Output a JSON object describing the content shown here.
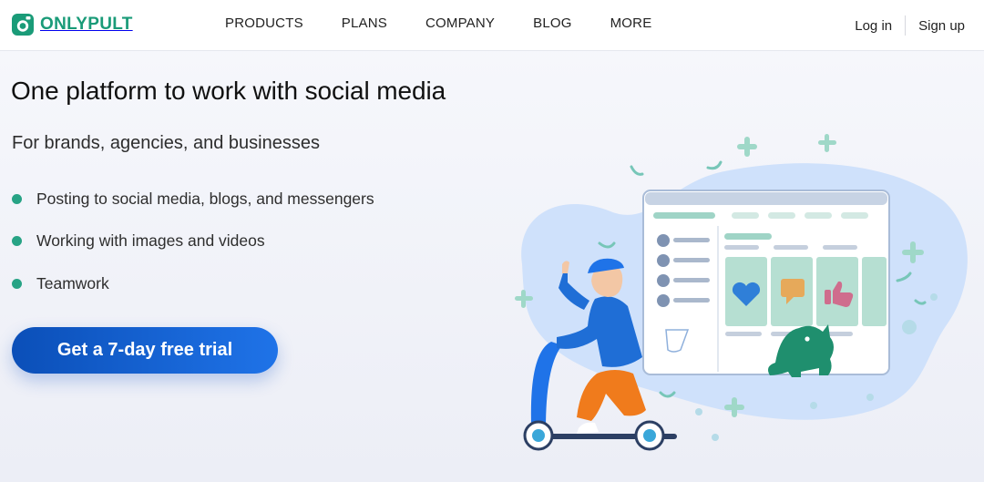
{
  "brand": {
    "name": "ONLYPULT",
    "color": "#1a9b78",
    "logo_icon": "camera-logo-icon"
  },
  "nav": {
    "items": [
      {
        "label": "PRODUCTS"
      },
      {
        "label": "PLANS"
      },
      {
        "label": "COMPANY"
      },
      {
        "label": "BLOG"
      },
      {
        "label": "MORE"
      }
    ]
  },
  "auth": {
    "login_label": "Log in",
    "signup_label": "Sign up"
  },
  "hero": {
    "title": "One platform to work with social media",
    "subtitle": "For brands, agencies, and businesses",
    "features": [
      {
        "text": "Posting to social media, blogs, and messengers"
      },
      {
        "text": "Working with images and videos"
      },
      {
        "text": "Teamwork"
      }
    ],
    "bullet_color": "#27a385",
    "cta_label": "Get a 7-day free trial",
    "cta_color": "#1561d6"
  },
  "illustration": {
    "icons": [
      "scooter-rider-icon",
      "dashboard-window-icon",
      "green-dog-icon",
      "heart-icon",
      "message-icon",
      "thumbs-up-icon"
    ],
    "accent_color": "#1f73e8",
    "blob_color": "#cfe1fb"
  }
}
